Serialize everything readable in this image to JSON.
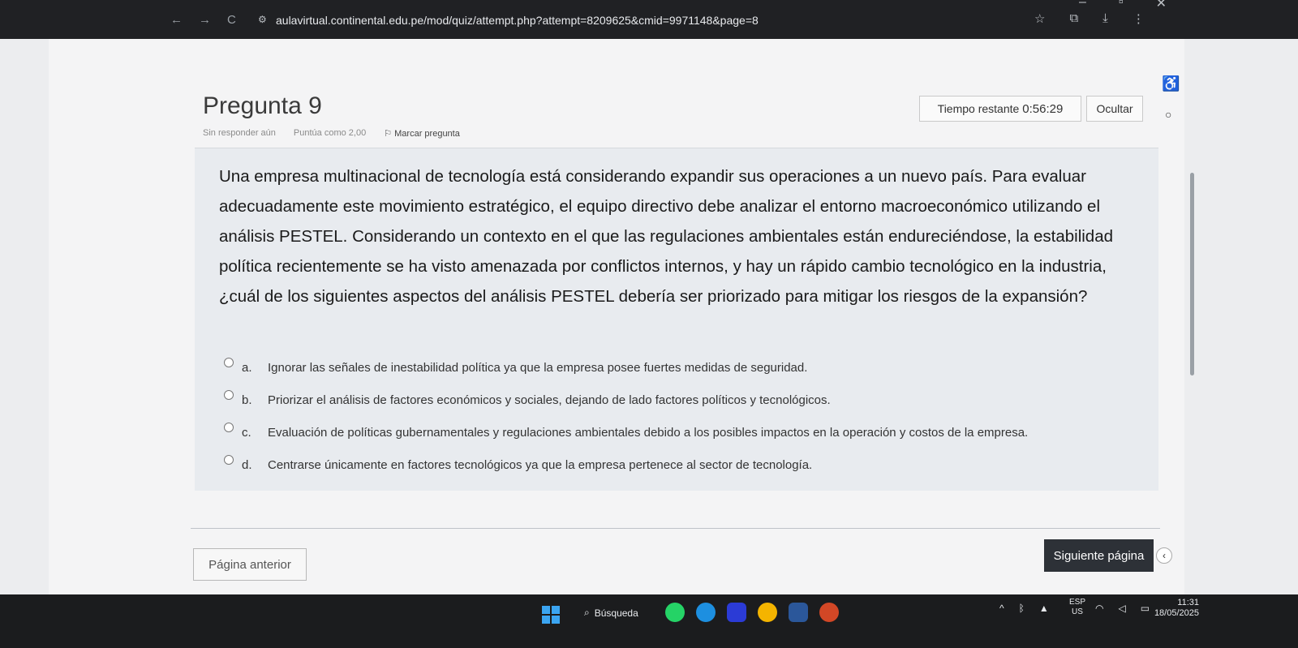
{
  "browser": {
    "url": "aulavirtual.continental.edu.pe/mod/quiz/attempt.php?attempt=8209625&cmid=9971148&page=8",
    "nav": {
      "back": "←",
      "forward": "→",
      "reload": "C"
    },
    "site_icon": "site-settings-icon",
    "actions": [
      "☆",
      "⧉",
      "⤓",
      "⋮"
    ],
    "window": {
      "minimize": "–",
      "restore": "▫",
      "close": "✕"
    }
  },
  "question": {
    "title": "Pregunta 9",
    "status": "Sin responder aún",
    "score": "Puntúa como 2,00",
    "flag_icon": "⚐",
    "flag_label": "Marcar pregunta",
    "text": "Una empresa multinacional de tecnología está considerando expandir sus operaciones a un nuevo país. Para evaluar adecuadamente este movimiento estratégico, el equipo directivo debe analizar el entorno macroeconómico utilizando el análisis PESTEL. Considerando un contexto en el que las regulaciones ambientales están endureciéndose, la estabilidad política recientemente se ha visto amenazada por conflictos internos, y hay un rápido cambio tecnológico en la industria, ¿cuál de los siguientes aspectos del análisis PESTEL debería ser priorizado para mitigar los riesgos de la expansión?",
    "answers": [
      {
        "letter": "a.",
        "text": "Ignorar las señales de inestabilidad política ya que la empresa posee fuertes medidas de seguridad."
      },
      {
        "letter": "b.",
        "text": "Priorizar el análisis de factores económicos y sociales, dejando de lado factores políticos y tecnológicos."
      },
      {
        "letter": "c.",
        "text": "Evaluación de políticas gubernamentales y regulaciones ambientales debido a los posibles impactos en la operación y costos de la empresa."
      },
      {
        "letter": "d.",
        "text": "Centrarse únicamente en factores tecnológicos ya que la empresa pertenece al sector de tecnología."
      }
    ]
  },
  "timer": {
    "label": "Tiempo restante",
    "value": "0:56:29"
  },
  "hide_button": "Ocultar",
  "navigation": {
    "prev": "Página anterior",
    "next": "Siguiente página"
  },
  "sidebar": {
    "collapse": "‹"
  },
  "taskbar": {
    "search": "Búsqueda",
    "tray_up": "^",
    "lang_top": "ESP",
    "lang_bottom": "US",
    "time": "11:31",
    "date": "18/05/2025",
    "colors": {
      "start": "#3ba5f2",
      "whatsapp": "#25d366",
      "edge": "#1d8fe0",
      "chatgpt": "#2b3bd6",
      "chrome": "#f4b400",
      "word": "#2b579a",
      "powerpoint": "#d24726"
    }
  }
}
